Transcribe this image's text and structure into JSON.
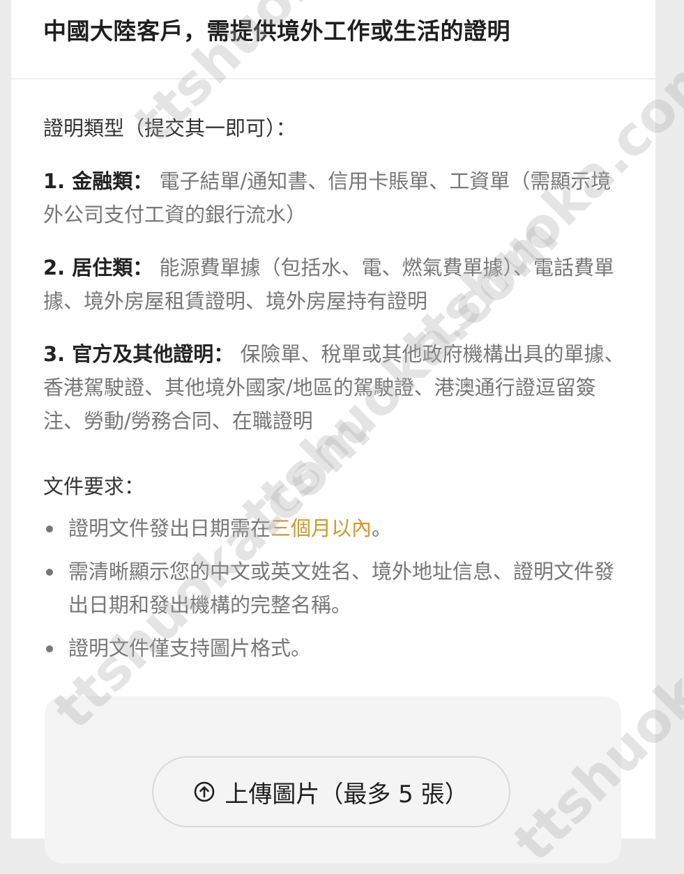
{
  "title": "中國大陸客戶，需提供境外工作或生活的證明",
  "proof_types": {
    "label": "證明類型（提交其一即可）：",
    "categories": [
      {
        "head": "1. 金融類：",
        "text": "電子結單/通知書、信用卡賬單、工資單（需顯示境外公司支付工資的銀行流水）"
      },
      {
        "head": "2. 居住類：",
        "text": "能源費單據（包括水、電、燃氣費單據）、電話費單據、境外房屋租賃證明、境外房屋持有證明"
      },
      {
        "head": "3. 官方及其他證明：",
        "text": "保險單、稅單或其他政府機構出具的單據、香港駕駛證、其他境外國家/地區的駕駛證、港澳通行證逗留簽注、勞動/勞務合同、在職證明"
      }
    ]
  },
  "requirements": {
    "label": "文件要求：",
    "items": [
      {
        "before": "證明文件發出日期需在",
        "highlight": "三個月以內",
        "after": "。"
      },
      {
        "before": "需清晰顯示您的中文或英文姓名、境外地址信息、證明文件發出日期和發出機構的完整名稱。",
        "highlight": "",
        "after": ""
      },
      {
        "before": "證明文件僅支持圖片格式。",
        "highlight": "",
        "after": ""
      }
    ]
  },
  "upload": {
    "button_label": "上傳圖片（最多 5 張）",
    "icon": "upload-arrow-circle-icon"
  },
  "watermark": "ttshuoka.com",
  "colors": {
    "highlight": "#d4962e",
    "background": "#ececec",
    "card": "#ffffff"
  }
}
